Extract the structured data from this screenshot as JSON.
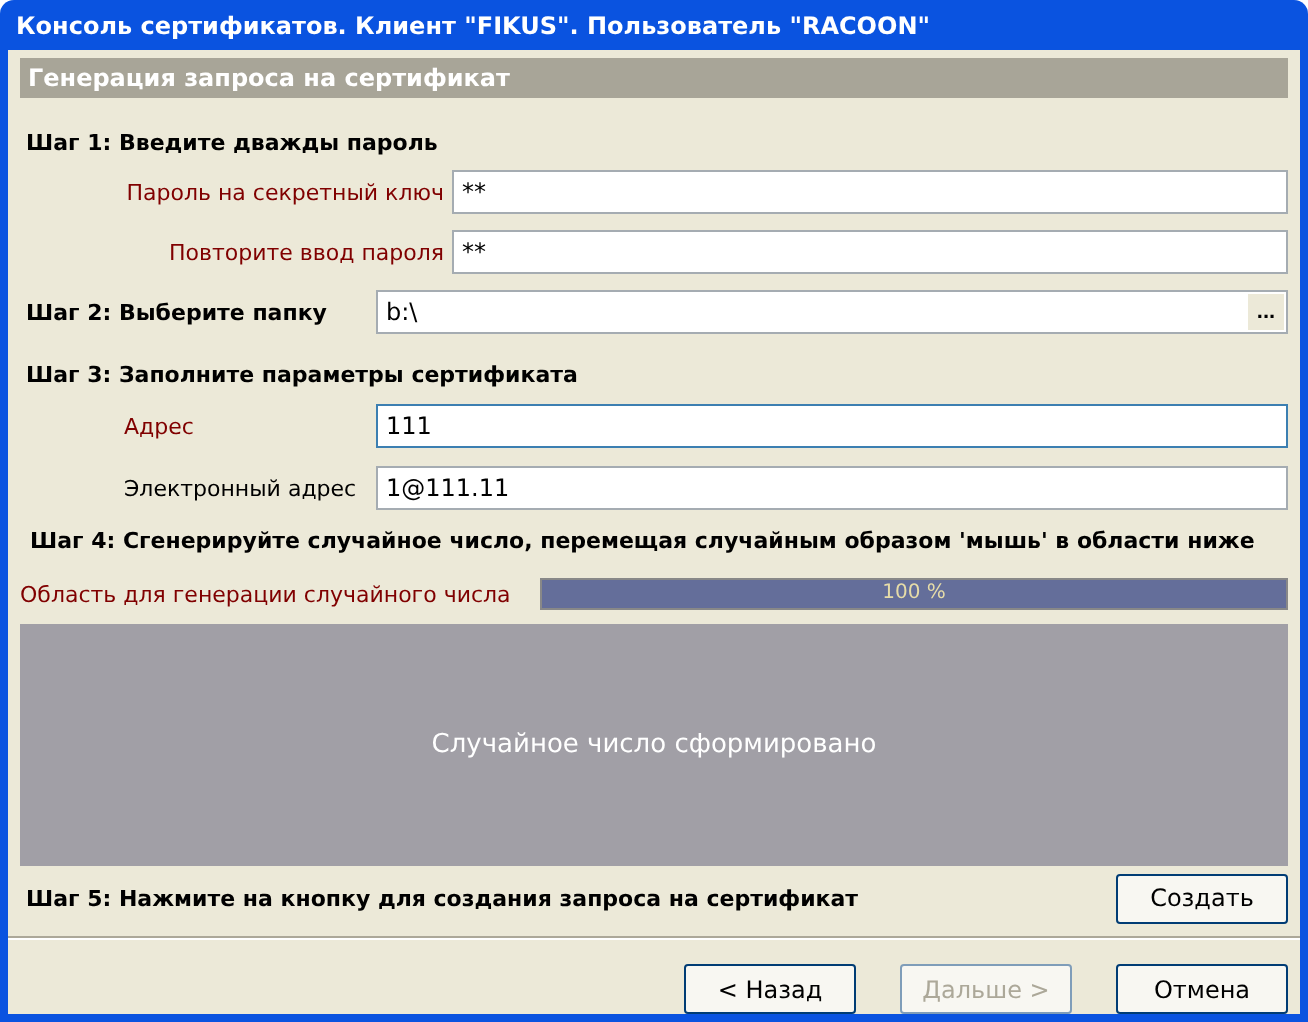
{
  "window": {
    "title": "Консоль сертификатов. Клиент \"FIKUS\". Пользователь \"RACOON\""
  },
  "header": "Генерация запроса на сертификат",
  "step1": {
    "label": "Шаг 1: Введите дважды пароль",
    "fields": [
      {
        "label": "Пароль на секретный ключ",
        "value": "**",
        "required": true,
        "focused": false
      },
      {
        "label": "Повторите ввод пароля",
        "value": "**",
        "required": true,
        "focused": false
      }
    ]
  },
  "step2": {
    "label": "Шаг 2: Выберите папку",
    "value": "b:\\",
    "browse": "..."
  },
  "step3": {
    "label": "Шаг 3: Заполните параметры сертификата",
    "fields": [
      {
        "label": "Адрес",
        "value": "111",
        "required": true,
        "focused": true
      },
      {
        "label": "Электронный адрес",
        "value": "1@111.11",
        "required": false,
        "focused": false
      }
    ]
  },
  "step4": {
    "label": "Шаг 4: Сгенерируйте случайное число, перемещая случайным образом 'мышь' в области ниже",
    "area_label": "Область для генерации случайного числа",
    "progress": {
      "level": 1,
      "text": "100 %"
    },
    "area_text": "Случайное число сформировано"
  },
  "step5": {
    "label": "Шаг 5: Нажмите на кнопку для создания запроса на сертификат",
    "button": "Создать"
  },
  "buttons": [
    {
      "label": "< Назад",
      "disabled": false
    },
    {
      "label": "Дальше >",
      "disabled": true
    },
    {
      "label": "Отмена",
      "disabled": false
    }
  ]
}
